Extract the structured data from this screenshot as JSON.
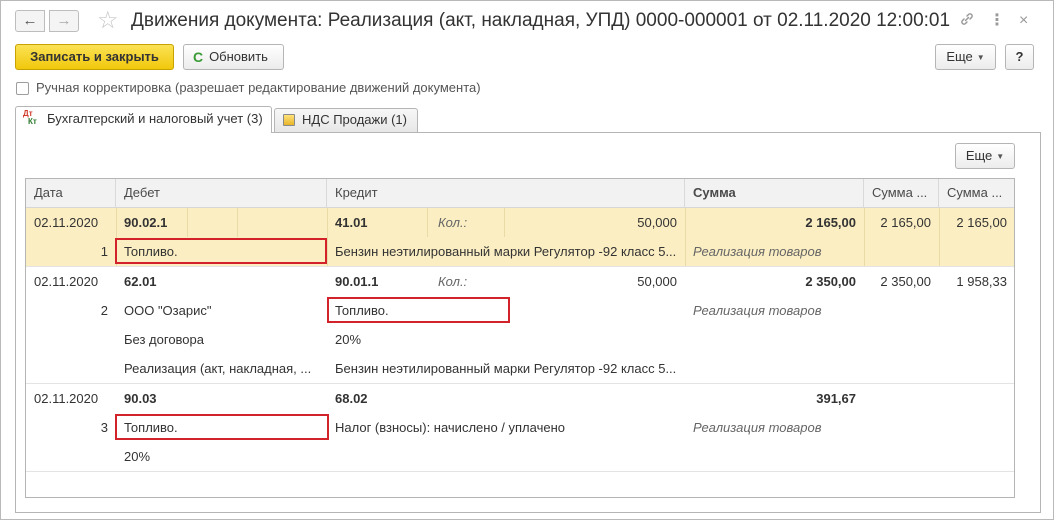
{
  "window": {
    "title": "Движения документа: Реализация (акт, накладная, УПД) 0000-000001 от 02.11.2020 12:00:01",
    "nav_back": "←",
    "nav_forward": "→",
    "star": "☆",
    "link_icon": "🔗",
    "more_icon": "⋮",
    "close_icon": "×"
  },
  "toolbar": {
    "save_close": "Записать и закрыть",
    "refresh": "Обновить",
    "refresh_icon": "C",
    "more": "Еще",
    "help": "?"
  },
  "manual_edit": {
    "label": "Ручная корректировка (разрешает редактирование движений документа)",
    "checked": false
  },
  "tabs": [
    {
      "label": "Бухгалтерский и налоговый учет (3)",
      "icon": "dt-kt-icon",
      "icon_dt": "Дт",
      "icon_kt": "Кт",
      "active": true
    },
    {
      "label": "НДС Продажи (1)",
      "icon": "vat-sales-icon",
      "active": false
    }
  ],
  "table": {
    "more": "Еще",
    "columns": {
      "date": "Дата",
      "debit": "Дебет",
      "credit": "Кредит",
      "sum": "Сумма",
      "sum2": "Сумма ...",
      "sum3": "Сумма ..."
    },
    "rows": [
      {
        "date": "02.11.2020",
        "num": "1",
        "debit_account": "90.02.1",
        "debit_sub1": "Топливо.",
        "credit_account": "41.01",
        "qty_label": "Кол.:",
        "qty": "50,000",
        "credit_sub1": "Бензин неэтилированный марки Регулятор -92 класс 5...",
        "sum": "2 165,00",
        "sum2": "2 165,00",
        "sum3": "2 165,00",
        "content": "Реализация товаров"
      },
      {
        "date": "02.11.2020",
        "num": "2",
        "debit_account": "62.01",
        "debit_sub1": "ООО \"Озарис\"",
        "debit_sub2": "Без договора",
        "debit_sub3": "Реализация (акт, накладная, ...",
        "credit_account": "90.01.1",
        "qty_label": "Кол.:",
        "qty": "50,000",
        "credit_sub1": "Топливо.",
        "credit_sub2": "20%",
        "credit_sub3": "Бензин неэтилированный марки Регулятор -92 класс 5...",
        "sum": "2 350,00",
        "sum2": "2 350,00",
        "sum3": "1 958,33",
        "content": "Реализация товаров"
      },
      {
        "date": "02.11.2020",
        "num": "3",
        "debit_account": "90.03",
        "debit_sub1": "Топливо.",
        "debit_sub2": "20%",
        "credit_account": "68.02",
        "credit_sub1": "Налог (взносы): начислено / уплачено",
        "sum": "391,67",
        "content": "Реализация товаров"
      }
    ]
  },
  "colors": {
    "primary_button": "#f4ce1f",
    "selected_row": "#fbeec2",
    "highlight_box": "#d2232a"
  }
}
